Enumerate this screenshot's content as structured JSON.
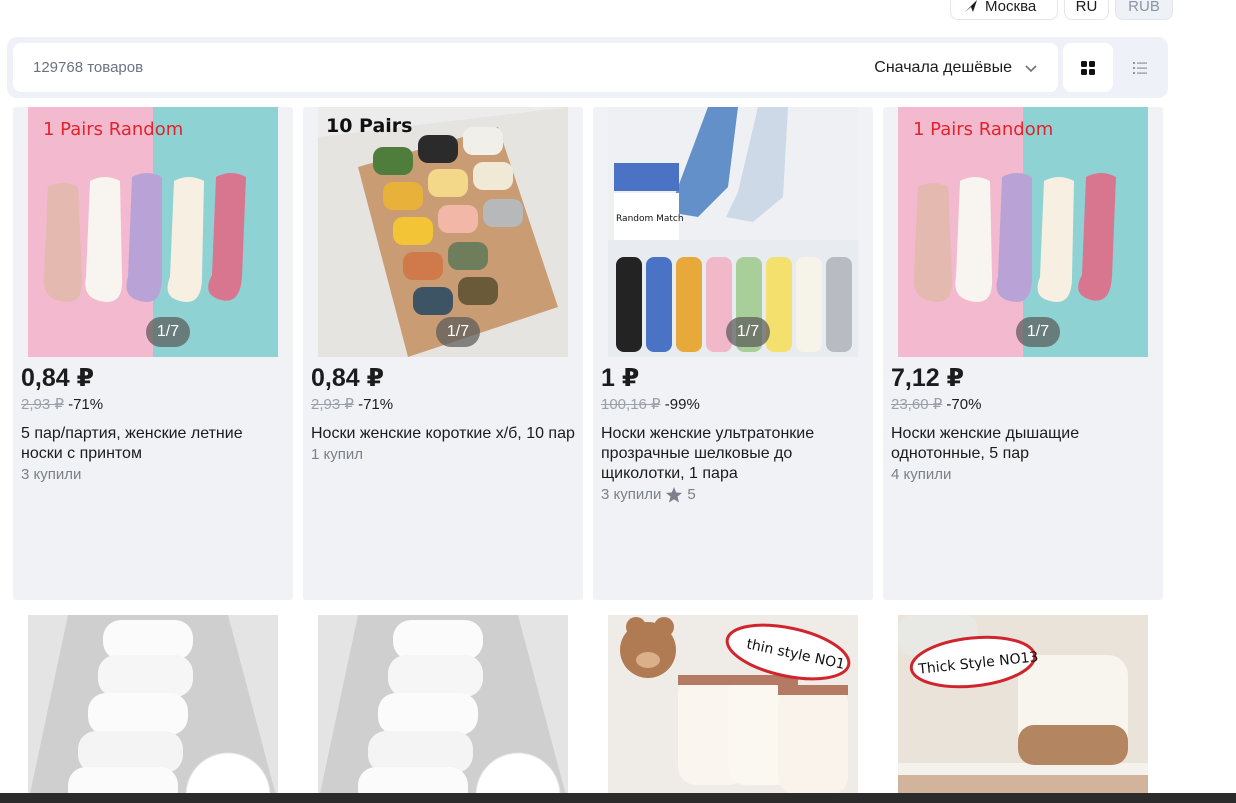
{
  "header": {
    "location": "Москва",
    "language": "RU",
    "currency": "RUB"
  },
  "toolbar": {
    "count": "129768 товаров",
    "sort": "Сначала дешёвые"
  },
  "products": [
    {
      "price": "0,84 ₽",
      "old_price": "2,93 ₽",
      "discount": "-71%",
      "title": "5 пар/партия, женские летние носки с принтом",
      "bought": "3 купили",
      "pager": "1/7",
      "badge": "1 Pairs Random"
    },
    {
      "price": "0,84 ₽",
      "old_price": "2,93 ₽",
      "discount": "-71%",
      "title": "Носки женские короткие х/б, 10 пар",
      "bought": "1 купил",
      "pager": "1/7",
      "badge": "10 Pairs"
    },
    {
      "price": "1 ₽",
      "old_price": "100,16 ₽",
      "discount": "-99%",
      "title": "Носки женские ультратонкие прозрачные шелковые до щиколотки, 1 пара",
      "bought": "3 купили",
      "rating": "5",
      "pager": "1/7",
      "badge": "Random Match"
    },
    {
      "price": "7,12 ₽",
      "old_price": "23,60 ₽",
      "discount": "-70%",
      "title": "Носки женские дышащие однотонные, 5 пар",
      "bought": "4 купили",
      "pager": "1/7",
      "badge": "1 Pairs Random"
    }
  ],
  "row2": [
    {
      "badge": ""
    },
    {
      "badge": ""
    },
    {
      "badge": "thin style NO1"
    },
    {
      "badge": "Thick Style NO13"
    }
  ],
  "colors": {
    "card_bg": "#f0f2f5",
    "toolbar_bg": "#eef1f7",
    "pager_bg": "#5a5a5a",
    "badge_red": "#e0242c"
  }
}
